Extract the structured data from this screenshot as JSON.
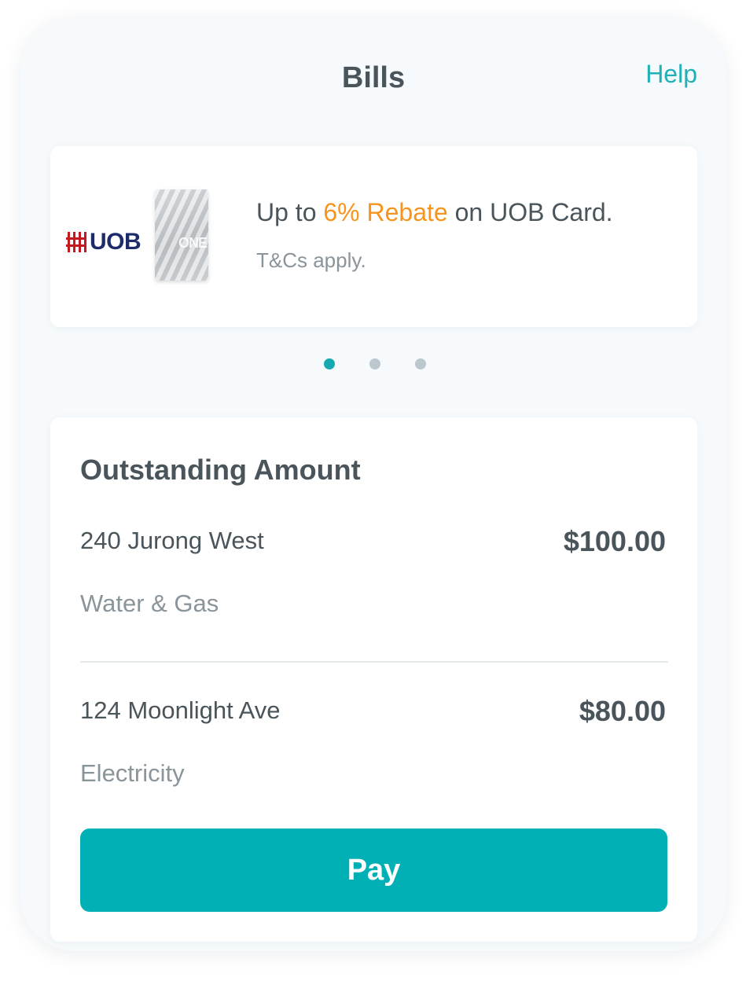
{
  "header": {
    "title": "Bills",
    "help_label": "Help"
  },
  "promo": {
    "bank_name": "UOB",
    "card_label": "ONE",
    "text_prefix": "Up to ",
    "text_highlight": "6% Rebate",
    "text_suffix": " on UOB Card.",
    "subtext": "T&Cs apply.",
    "highlight_color": "#f7941d"
  },
  "carousel": {
    "page_count": 3,
    "active_index": 0
  },
  "outstanding": {
    "title": "Outstanding Amount",
    "bills": [
      {
        "address": "240 Jurong West",
        "amount": "$100.00",
        "type": "Water & Gas"
      },
      {
        "address": "124 Moonlight Ave",
        "amount": "$80.00",
        "type": "Electricity"
      }
    ],
    "pay_label": "Pay"
  },
  "colors": {
    "accent": "#00b0b5",
    "text_primary": "#4a545b",
    "text_secondary": "#8a949b"
  }
}
